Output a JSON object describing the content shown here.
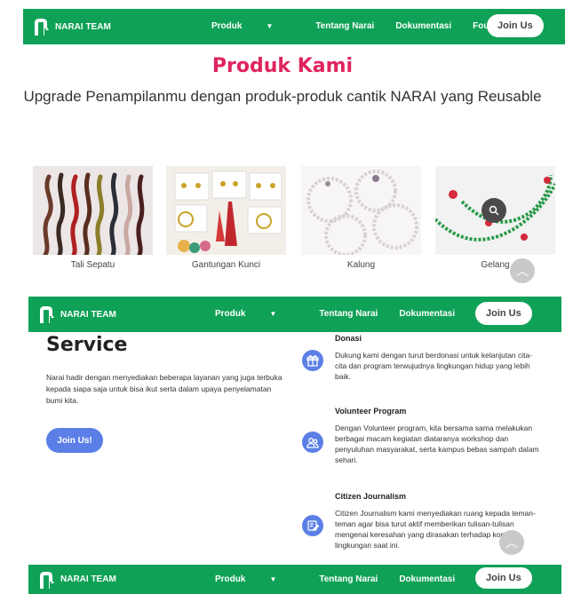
{
  "nav": {
    "brand": "NARAI TEAM",
    "links": [
      "Produk",
      "Tentang Narai",
      "Dokumentasi",
      "Founder"
    ],
    "join": "Join Us"
  },
  "products": {
    "title": "Produk Kami",
    "subtitle": "Upgrade Penampilanmu dengan produk-produk cantik NARAI yang Reusable",
    "items": [
      {
        "label": "Tali Sepatu"
      },
      {
        "label": "Gantungan Kunci"
      },
      {
        "label": "Kalung"
      },
      {
        "label": "Gelang"
      }
    ]
  },
  "service": {
    "title": "Service",
    "description": "Narai hadir dengan menyediakan beberapa layanan yang juga terbuka kepada siapa saja untuk bisa ikut serta dalam upaya penyelamatan bumi kita.",
    "button": "Join Us!",
    "items": [
      {
        "heading": "Donasi",
        "text": "Dukung kami dengan turut berdonasi untuk kelanjutan cita-cita dan program terwujudnya lingkungan hidup yang lebih baik.",
        "icon": "gift-icon"
      },
      {
        "heading": "Volunteer Program",
        "text": "Dengan Volunteer program, kita bersama sama melakukan berbagai macam kegiatan diataranya workshop dan penyuluhan masyarakat, serta kampus bebas sampah dalam sehari.",
        "icon": "people-icon"
      },
      {
        "heading": "Citizen Journalism",
        "text": "Citizen Journalism kami menyediakan ruang kepada teman-teman agar bisa turut aktif memberikan tulisan-tulisan mengenai keresahan yang dirasakan terhadap kondisi lingkungan saat ini.",
        "icon": "edit-icon"
      }
    ]
  },
  "colors": {
    "nav": "#0fa156",
    "accent": "#e0245e",
    "button": "#5b7fe6"
  }
}
